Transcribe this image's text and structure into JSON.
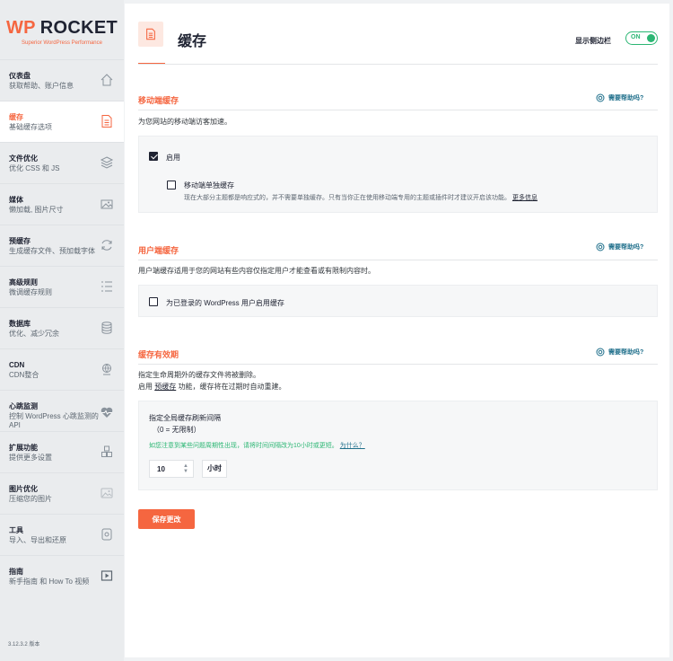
{
  "logo": {
    "wp": "WP",
    "rocket": "ROCKET",
    "subtitle": "Superior WordPress Performance"
  },
  "sidebar": {
    "items": [
      {
        "title": "仪表盘",
        "desc": "获取帮助、账户信息",
        "icon": "home-icon"
      },
      {
        "title": "缓存",
        "desc": "基础缓存选项",
        "icon": "cache-file-icon",
        "active": true
      },
      {
        "title": "文件优化",
        "desc": "优化 CSS 和 JS",
        "icon": "stack-layers-icon"
      },
      {
        "title": "媒体",
        "desc": "懒加载, 图片尺寸",
        "icon": "media-image-icon"
      },
      {
        "title": "预缓存",
        "desc": "生成缓存文件、预加载字体",
        "icon": "refresh-icon"
      },
      {
        "title": "高级规则",
        "desc": "微调缓存规则",
        "icon": "list-rules-icon"
      },
      {
        "title": "数据库",
        "desc": "优化、减少冗余",
        "icon": "database-icon"
      },
      {
        "title": "CDN",
        "desc": "CDN整合",
        "icon": "cdn-globe-icon"
      },
      {
        "title": "心跳监测",
        "desc": "控制 WordPress 心跳监测的 API",
        "icon": "heartbeat-icon"
      },
      {
        "title": "扩展功能",
        "desc": "提供更多设置",
        "icon": "addons-cubes-icon"
      },
      {
        "title": "图片优化",
        "desc": "压缩您的图片",
        "icon": "image-optimize-icon"
      },
      {
        "title": "工具",
        "desc": "导入、导出和还原",
        "icon": "tools-icon"
      },
      {
        "title": "指南",
        "desc": "新手指南 和 How To 视频",
        "icon": "video-tutorial-icon"
      }
    ],
    "version": "3.12.3.2 版本"
  },
  "header": {
    "title": "缓存",
    "sidebar_toggle_label": "显示侧边栏",
    "toggle_state": "ON"
  },
  "help_label": "需要帮助吗?",
  "mobile": {
    "title": "移动端缓存",
    "desc": "为您网站的移动端访客加速。",
    "enable_label": "启用",
    "separate_label": "移动端单独缓存",
    "separate_desc": "现在大部分主题都是响应式的，并不需要单独缓存。只有当你正在使用移动端专用的主题或插件时才建议开启该功能。",
    "more_info": "更多信息"
  },
  "user": {
    "title": "用户端缓存",
    "desc": "用户端缓存适用于您的网站有些内容仅指定用户才能查看或有限制内容时。",
    "enable_label": "为已登录的 WordPress 用户启用缓存"
  },
  "lifespan": {
    "title": "缓存有效期",
    "desc1": "指定生命周期外的缓存文件将被删除。",
    "desc2_pre": "启用",
    "desc2_link": "预缓存",
    "desc2_post": "功能，缓存将在过期时自动重建。",
    "field_label": "指定全局缓存刷新间隔",
    "field_hint": "（0 = 无限制）",
    "note": "如您注意到某些问题周期性出现，请将时间间隔改为10小时或更短。",
    "why_link": "为什么？",
    "value": "10",
    "unit": "小时"
  },
  "save_button": "保存更改",
  "colors": {
    "accent": "#f56640",
    "dark": "#1f2332",
    "green": "#2bb673",
    "help": "#1f6f8b"
  }
}
